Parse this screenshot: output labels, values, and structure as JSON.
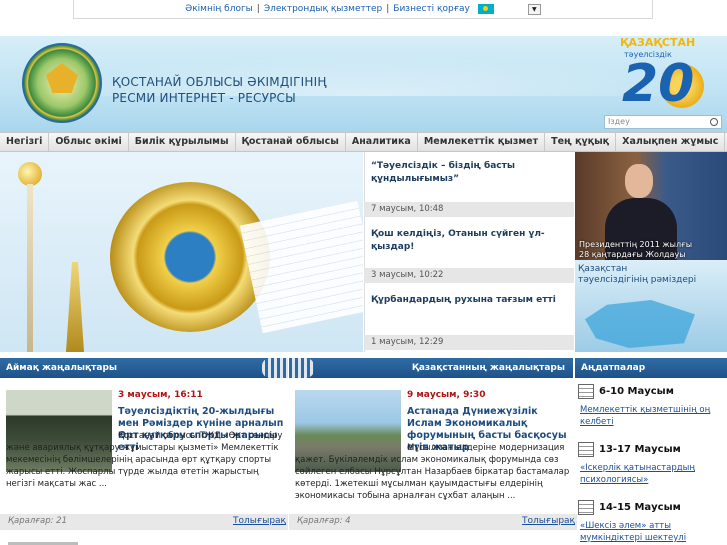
{
  "topbar": {
    "links": [
      "Әкімнің блогы",
      "Электрондық қызметтер",
      "Бизнесті қорғау"
    ],
    "separator": "|"
  },
  "header": {
    "title_line1": "ҚОСТАНАЙ ОБЛЫСЫ ӘКІМДІГІНІҢ",
    "title_line2": "РЕСМИ ИНТЕРНЕТ - РЕСУРСЫ",
    "logo_kz": "ҚАЗАҚСТАН",
    "logo_sub": "тәуелсіздік",
    "logo_num": "20",
    "search_placeholder": "Іздеу"
  },
  "nav": {
    "items": [
      "Негізгі",
      "Облыс әкімі",
      "Билік құрылымы",
      "Қостанай облысы",
      "Аналитика",
      "Мемлекеттік қызмет",
      "Тең құқық",
      "Халықпен жұмыс"
    ]
  },
  "headlines": [
    {
      "title": "“Тәуелсіздік – біздің басты құндылығымыз”",
      "date": "7 маусым, 10:48"
    },
    {
      "title": "Қош келдіңіз, Отанын сүйген ұл-қыздар!",
      "date": "3 маусым, 10:22"
    },
    {
      "title": "Құрбандардың рухына тағзым етті",
      "date": "1 маусым, 12:29"
    }
  ],
  "president": {
    "caption_line1": "Президенттің 2011 жылғы",
    "caption_line2": "28 қаңтардағы Жолдауы",
    "symbols_line1": "Қазақстан",
    "symbols_line2": "тәуелсіздігінің рәміздері"
  },
  "sections": {
    "regional": "Аймақ жаңалықтары",
    "kazakhstan": "Қазақстанның жаңалықтары",
    "calendar": "Аңдатпалар"
  },
  "news": [
    {
      "date": "3 маусым, 16:11",
      "title": "Тәуелсіздіктің 20-жылдығы мен Рәміздер күніне арналып Өрт құтқару спорты жарысы етті",
      "body": "Қостанай облысы ТЖД «Өрт сөндіру және авариялық құтқару жұмыстары қызметі» Мемлекеттік мекемесінің бөлімшелерінің арасында өрт құтқару спорты жарысы етті. Жоспарлы түрде жылда өтетін жарыстың негізгі мақсаты жас ...",
      "views": "Қаралғар: 21",
      "more": "Толығырақ"
    },
    {
      "date": "9 маусым, 9:30",
      "title": "Астанада Дүниежүзілік Ислам Экономикалық форумының басты басқосуы етіп жатыр",
      "body": "Мұсылман елдеріне модернизация қажет. Бүкіләлемдік ислам экономикалық форумында сөз сөйлеген елбасы Нұрсұлтан Назарбаев біркатар бастамалар көтерді. 1жетекші мұсылман қауымдастығы елдерінің экономикасы тобына арналған сұхбат алаңын ...",
      "views": "Қаралғар: 4",
      "more": "Толығырақ"
    }
  ],
  "calendar": [
    {
      "date": "6-10 Маусым",
      "text": "Мемлекеттік қызметшінің оң келбеті"
    },
    {
      "date": "13-17 Маусым",
      "text": "«Іскерлік қатынастардың психологиясы»"
    },
    {
      "date": "14-15 Маусым",
      "text": "«Шексіз әлем» атты мүмкіндіктері шектеулі адамдар"
    }
  ],
  "colors": {
    "nav_bar": "#e2e2e2",
    "section_bar": "#1e5289",
    "link": "#1a4f9a",
    "date_red": "#b01515"
  }
}
